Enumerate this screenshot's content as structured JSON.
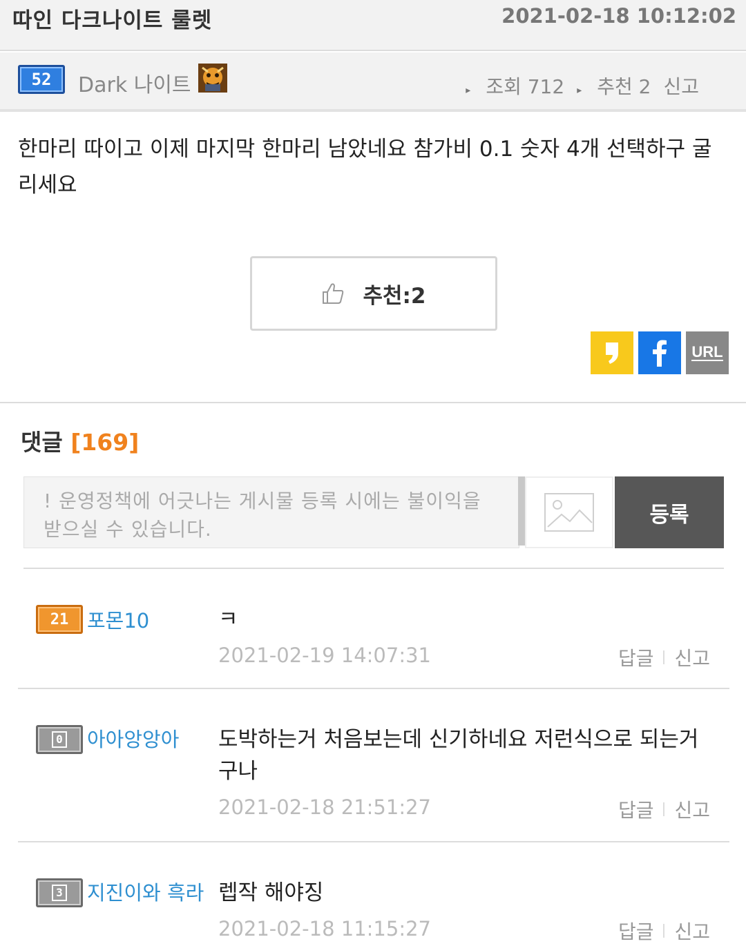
{
  "post": {
    "title": "따인 다크나이트 룰렛",
    "date": "2021-02-18 10:12:02",
    "author": {
      "level": "52",
      "name": "Dark 나이트"
    },
    "views_label": "조회 712",
    "recommend_label": "추천 2",
    "report_label": "신고",
    "body": "한마리 따이고 이제 마지막 한마리 남았네요 참가비 0.1 숫자 4개 선택하구 굴리세요",
    "like_button_label": "추천:2"
  },
  "share": {
    "kakao_icon": "kakao-story-icon",
    "facebook_icon": "facebook-icon",
    "url_label": "URL"
  },
  "comments_section": {
    "title": "댓글",
    "count": "[169]",
    "input_placeholder": "! 운영정책에 어긋나는 게시물 등록 시에는 불이익을 받으실 수 있습니다.",
    "submit_label": "등록",
    "image_icon": "image-icon"
  },
  "comments": [
    {
      "level": "21",
      "name": "포몬10",
      "text": "ㅋ",
      "date": "2021-02-19 14:07:31",
      "reply_label": "답글",
      "report_label": "신고"
    },
    {
      "level": "0",
      "name": "아아앙앙아",
      "text": "도박하는거 처음보는데 신기하네요 저런식으로 되는거구나",
      "date": "2021-02-18 21:51:27",
      "reply_label": "답글",
      "report_label": "신고"
    },
    {
      "level": "3",
      "name": "지진이와 흑라",
      "text": "렙작 해야징",
      "date": "2021-02-18 11:15:27",
      "reply_label": "답글",
      "report_label": "신고"
    }
  ],
  "colors": {
    "accent_orange": "#f0821e",
    "link_blue": "#2e8fd0",
    "kakao_yellow": "#f8c91c",
    "facebook_blue": "#1877e6"
  }
}
